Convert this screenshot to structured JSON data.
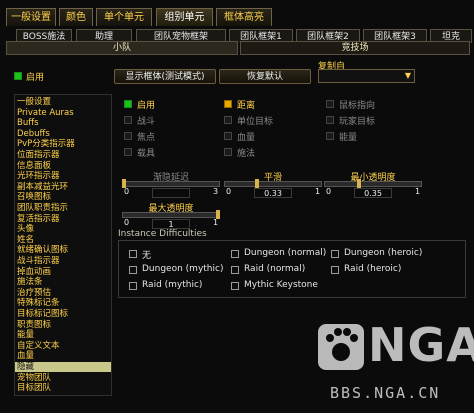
{
  "top_tabs": [
    "一般设置",
    "颜色",
    "单个单元",
    "组别单元",
    "框体高亮"
  ],
  "sub_tabs": [
    "BOSS施法",
    "助理",
    "团队宠物框架",
    "团队框架1",
    "团队框架2",
    "团队框架3",
    "坦克"
  ],
  "group_tabs": [
    "小队",
    "竞技场"
  ],
  "enable_label": "启用",
  "buttons": {
    "show_frames": "显示框体(测试模式)",
    "restore_default": "恢复默认"
  },
  "copy_from": {
    "label": "复制自",
    "value": ""
  },
  "sidebar": [
    "一般设置",
    "Private Auras",
    "Buffs",
    "Debuffs",
    "PvP分类指示器",
    "位面指示器",
    "信息面板",
    "光环指示器",
    "副本减益光环",
    "召唤图标",
    "团队职责指示",
    "复活指示器",
    "头像",
    "姓名",
    "就绪确认图标",
    "战斗指示器",
    "掉血动画",
    "施法条",
    "治疗预估",
    "特殊标记条",
    "目标标记图标",
    "职责图标",
    "能量",
    "自定义文本",
    "血量",
    "隐藏",
    "宠物团队",
    "目标团队"
  ],
  "sidebar_selected": 25,
  "options": {
    "col1": [
      {
        "label": "启用",
        "state": "on"
      },
      {
        "label": "战斗",
        "state": "dim"
      },
      {
        "label": "焦点",
        "state": "dim"
      },
      {
        "label": "载具",
        "state": "dim"
      }
    ],
    "col2": [
      {
        "label": "距离",
        "state": "mark"
      },
      {
        "label": "单位目标",
        "state": "dim"
      },
      {
        "label": "血量",
        "state": "dim"
      },
      {
        "label": "施法",
        "state": "dim"
      }
    ],
    "col3": [
      {
        "label": "鼠标指向",
        "state": "dim"
      },
      {
        "label": "玩家目标",
        "state": "dim"
      },
      {
        "label": "能量",
        "state": "dim"
      }
    ]
  },
  "sliders": [
    {
      "label": "渐隐延迟",
      "value": "",
      "min": "0",
      "max": "3",
      "disabled": true
    },
    {
      "label": "平滑",
      "value": "0.33",
      "min": "0",
      "max": "1",
      "disabled": false
    },
    {
      "label": "最小透明度",
      "value": "0.35",
      "min": "0",
      "max": "1",
      "disabled": false
    },
    {
      "label": "最大透明度",
      "value": "1",
      "min": "0",
      "max": "1",
      "disabled": false
    }
  ],
  "instance": {
    "title": "Instance Difficulties",
    "items": [
      "无",
      "Dungeon (normal)",
      "Dungeon (heroic)",
      "Dungeon (mythic)",
      "Raid (normal)",
      "Raid (heroic)",
      "Raid (mythic)",
      "Mythic Keystone"
    ]
  },
  "watermark": {
    "logo": "NGA",
    "url": "BBS.NGA.CN"
  }
}
